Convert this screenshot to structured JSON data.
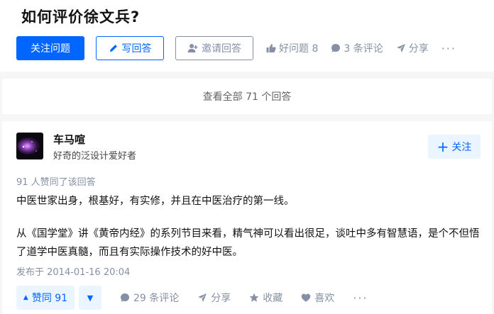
{
  "question": {
    "title": "如何评价徐文兵?",
    "follow_label": "关注问题",
    "write_answer_label": "写回答",
    "invite_label": "邀请回答",
    "good_question_label": "好问题 8",
    "comments_label": "3 条评论",
    "share_label": "分享",
    "more_label": "···"
  },
  "view_all": {
    "label": "查看全部 71 个回答"
  },
  "answer": {
    "author_name": "车马喧",
    "author_bio": "好奇的泛设计爱好者",
    "follow_label": "关注",
    "upvote_info": "91 人赞同了该回答",
    "paragraphs": [
      "中医世家出身，根基好，有实修，并且在中医治疗的第一线。",
      "从《国学堂》讲《黄帝内经》的系列节目来看，精气神可以看出很足，谈吐中多有智慧语，是个不但悟了道学中医真髓，而且有实际操作技术的好中医。"
    ],
    "publish_time": "发布于 2014-01-16 20:04",
    "vote_up_label": "赞同 91",
    "comments_label": "29 条评论",
    "share_label": "分享",
    "collect_label": "收藏",
    "like_label": "喜欢",
    "more_label": "···"
  },
  "colors": {
    "brand": "#0066ff",
    "muted": "#8590a6",
    "brand_light": "#ebf5ff"
  }
}
